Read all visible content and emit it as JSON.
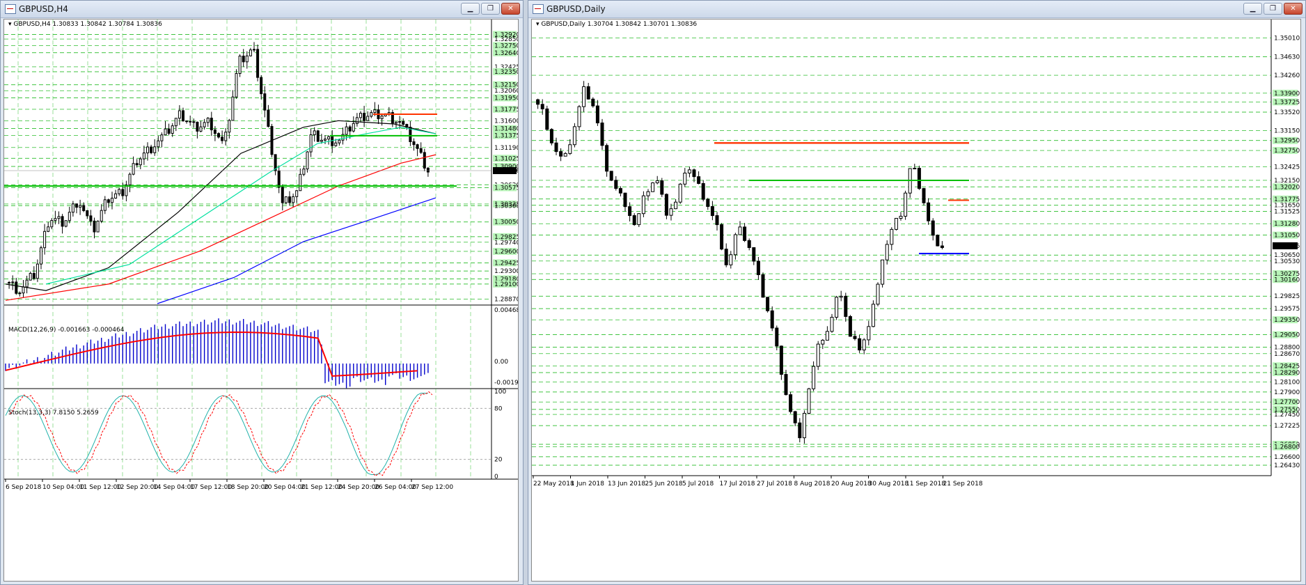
{
  "left_window": {
    "title": "GBPUSD,H4",
    "header": "GBPUSD,H4  1.30833 1.30842 1.30784 1.30836",
    "macd_header": "MACD(12,26,9) -0.001663 -0.000464",
    "stoch_header": "Stoch(13,3,3) 7.8150 5.2659",
    "current_price_label": "1.30836",
    "price_axis": [
      "1.32920",
      "1.32850",
      "1.32750",
      "1.32640",
      "1.32425",
      "1.32350",
      "1.32150",
      "1.32060",
      "1.31950",
      "1.31775",
      "1.31600",
      "1.31480",
      "1.31375",
      "1.31190",
      "1.31025",
      "1.30900",
      "1.30620",
      "1.30575",
      "1.30325",
      "1.30300",
      "1.30050",
      "1.29825",
      "1.29740",
      "1.29600",
      "1.29425",
      "1.29300",
      "1.29180",
      "1.29100",
      "1.28870"
    ],
    "macd_axis": [
      "0.004685",
      "0.00",
      "-0.001965"
    ],
    "stoch_axis": [
      "100",
      "80",
      "20",
      "0"
    ],
    "time_axis": [
      "6 Sep 2018",
      "10 Sep 04:00",
      "11 Sep 12:00",
      "12 Sep 20:00",
      "14 Sep 04:00",
      "17 Sep 12:00",
      "18 Sep 20:00",
      "20 Sep 04:00",
      "21 Sep 12:00",
      "24 Sep 20:00",
      "26 Sep 04:00",
      "27 Sep 12:00"
    ]
  },
  "right_window": {
    "title": "GBPUSD,Daily",
    "header": "GBPUSD,Daily  1.30704 1.30842 1.30701 1.30836",
    "current_price_label": "1.30836",
    "price_axis": [
      "1.35010",
      "1.34630",
      "1.34260",
      "1.33900",
      "1.33725",
      "1.33520",
      "1.33150",
      "1.32950",
      "1.32750",
      "1.32425",
      "1.32150",
      "1.32020",
      "1.31775",
      "1.31650",
      "1.31525",
      "1.31280",
      "1.31050",
      "1.30650",
      "1.30530",
      "1.30275",
      "1.30160",
      "1.29825",
      "1.29575",
      "1.29350",
      "1.29050",
      "1.28800",
      "1.28670",
      "1.28425",
      "1.28290",
      "1.28100",
      "1.27900",
      "1.27700",
      "1.27550",
      "1.27450",
      "1.27225",
      "1.26850",
      "1.26800",
      "1.26600",
      "1.26430"
    ],
    "time_axis": [
      "22 May 2018",
      "1 Jun 2018",
      "13 Jun 2018",
      "25 Jun 2018",
      "5 Jul 2018",
      "17 Jul 2018",
      "27 Jul 2018",
      "8 Aug 2018",
      "20 Aug 2018",
      "30 Aug 2018",
      "11 Sep 2018",
      "21 Sep 2018"
    ]
  },
  "colors": {
    "resistance": "#ff3300",
    "support_green": "#00c000",
    "ma_blue": "#0000ff",
    "ma_red": "#ff0000",
    "ma_cyan": "#00e0a0",
    "macd_signal": "#ff0000",
    "macd_hist": "#0000cc",
    "stoch_main": "#20b2aa",
    "stoch_signal": "#ff0000",
    "grid_green": "#00a000",
    "label_bg": "#c0ffc0"
  }
}
